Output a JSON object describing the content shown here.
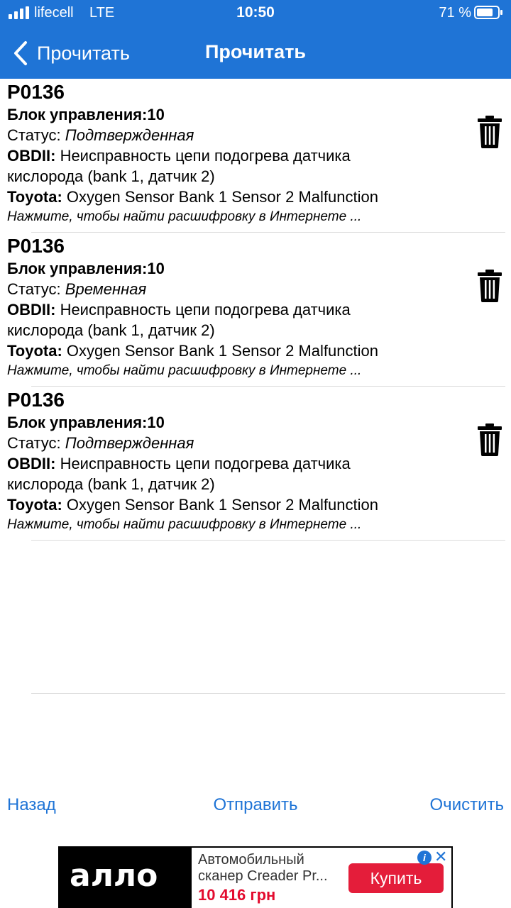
{
  "status_bar": {
    "carrier": "lifecell",
    "network": "LTE",
    "time": "10:50",
    "battery": "71 %"
  },
  "nav": {
    "back_label": "Прочитать",
    "title": "Прочитать"
  },
  "labels": {
    "ecu": "Блок управления:",
    "status": "Статус: ",
    "obd": "OBDII: ",
    "make": "Toyota: ",
    "hint": "Нажмите, чтобы найти расшифровку в Интернете ..."
  },
  "codes": [
    {
      "code": "P0136",
      "ecu": "10",
      "status": "Подтвержденная",
      "obd_line1": "Неисправность цепи подогрева датчика",
      "obd_line2": "кислорода (bank 1, датчик 2)",
      "make_desc": "Oxygen Sensor Bank 1 Sensor 2 Malfunction"
    },
    {
      "code": "P0136",
      "ecu": "10",
      "status": "Временная",
      "obd_line1": "Неисправность цепи подогрева датчика",
      "obd_line2": "кислорода (bank 1, датчик 2)",
      "make_desc": "Oxygen Sensor Bank 1 Sensor 2 Malfunction"
    },
    {
      "code": "P0136",
      "ecu": "10",
      "status": "Подтвержденная",
      "obd_line1": "Неисправность цепи подогрева датчика",
      "obd_line2": "кислорода (bank 1, датчик 2)",
      "make_desc": "Oxygen Sensor Bank 1 Sensor 2 Malfunction"
    }
  ],
  "toolbar": {
    "back": "Назад",
    "send": "Отправить",
    "clear": "Очистить"
  },
  "ad": {
    "brand": "алло",
    "title": "Автомобильный сканер Creader Pr...",
    "price": "10 416 грн",
    "buy": "Купить"
  },
  "colors": {
    "accent": "#1f74d6",
    "ad_price": "#e30b2e",
    "ad_button": "#e41d3a"
  },
  "icons": [
    "signal-icon",
    "battery-icon",
    "chevron-left-icon",
    "trash-icon",
    "info-icon",
    "close-icon"
  ]
}
